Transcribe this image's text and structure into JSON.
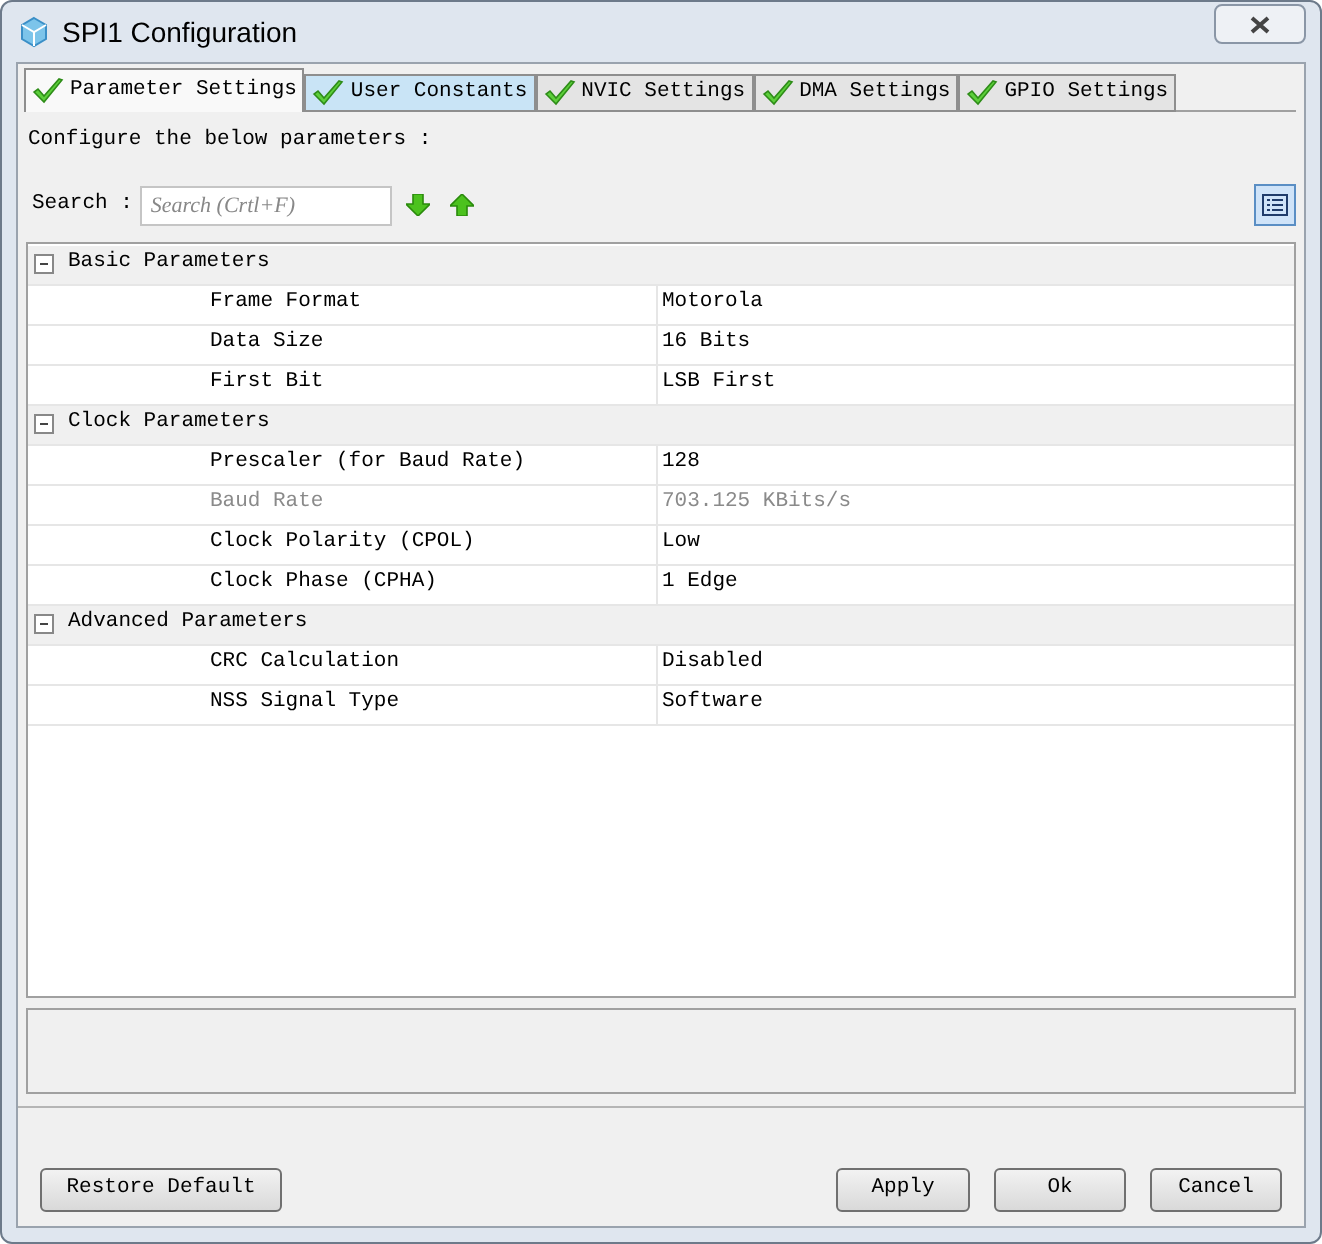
{
  "window": {
    "title": "SPI1 Configuration"
  },
  "tabs": [
    {
      "label": "Parameter Settings",
      "selected": true,
      "hovered": false
    },
    {
      "label": "User Constants",
      "selected": false,
      "hovered": true
    },
    {
      "label": "NVIC Settings",
      "selected": false,
      "hovered": false
    },
    {
      "label": "DMA Settings",
      "selected": false,
      "hovered": false
    },
    {
      "label": "GPIO Settings",
      "selected": false,
      "hovered": false
    }
  ],
  "instructions": "Configure the below parameters :",
  "search": {
    "label": "Search :",
    "placeholder": "Search (Crtl+F)"
  },
  "groups": [
    {
      "name": "Basic Parameters",
      "expanded": true,
      "params": [
        {
          "name": "Frame Format",
          "value": "Motorola",
          "disabled": false
        },
        {
          "name": "Data Size",
          "value": "16 Bits",
          "disabled": false
        },
        {
          "name": "First Bit",
          "value": "LSB First",
          "disabled": false
        }
      ]
    },
    {
      "name": "Clock Parameters",
      "expanded": true,
      "params": [
        {
          "name": "Prescaler (for Baud Rate)",
          "value": "128",
          "disabled": false
        },
        {
          "name": "Baud Rate",
          "value": "703.125 KBits/s",
          "disabled": true
        },
        {
          "name": "Clock Polarity (CPOL)",
          "value": "Low",
          "disabled": false
        },
        {
          "name": "Clock Phase (CPHA)",
          "value": "1 Edge",
          "disabled": false
        }
      ]
    },
    {
      "name": "Advanced Parameters",
      "expanded": true,
      "params": [
        {
          "name": "CRC Calculation",
          "value": "Disabled",
          "disabled": false
        },
        {
          "name": "NSS Signal Type",
          "value": "Software",
          "disabled": false
        }
      ]
    }
  ],
  "buttons": {
    "left": "Restore Default",
    "right": [
      "Apply",
      "Ok",
      "Cancel"
    ]
  }
}
